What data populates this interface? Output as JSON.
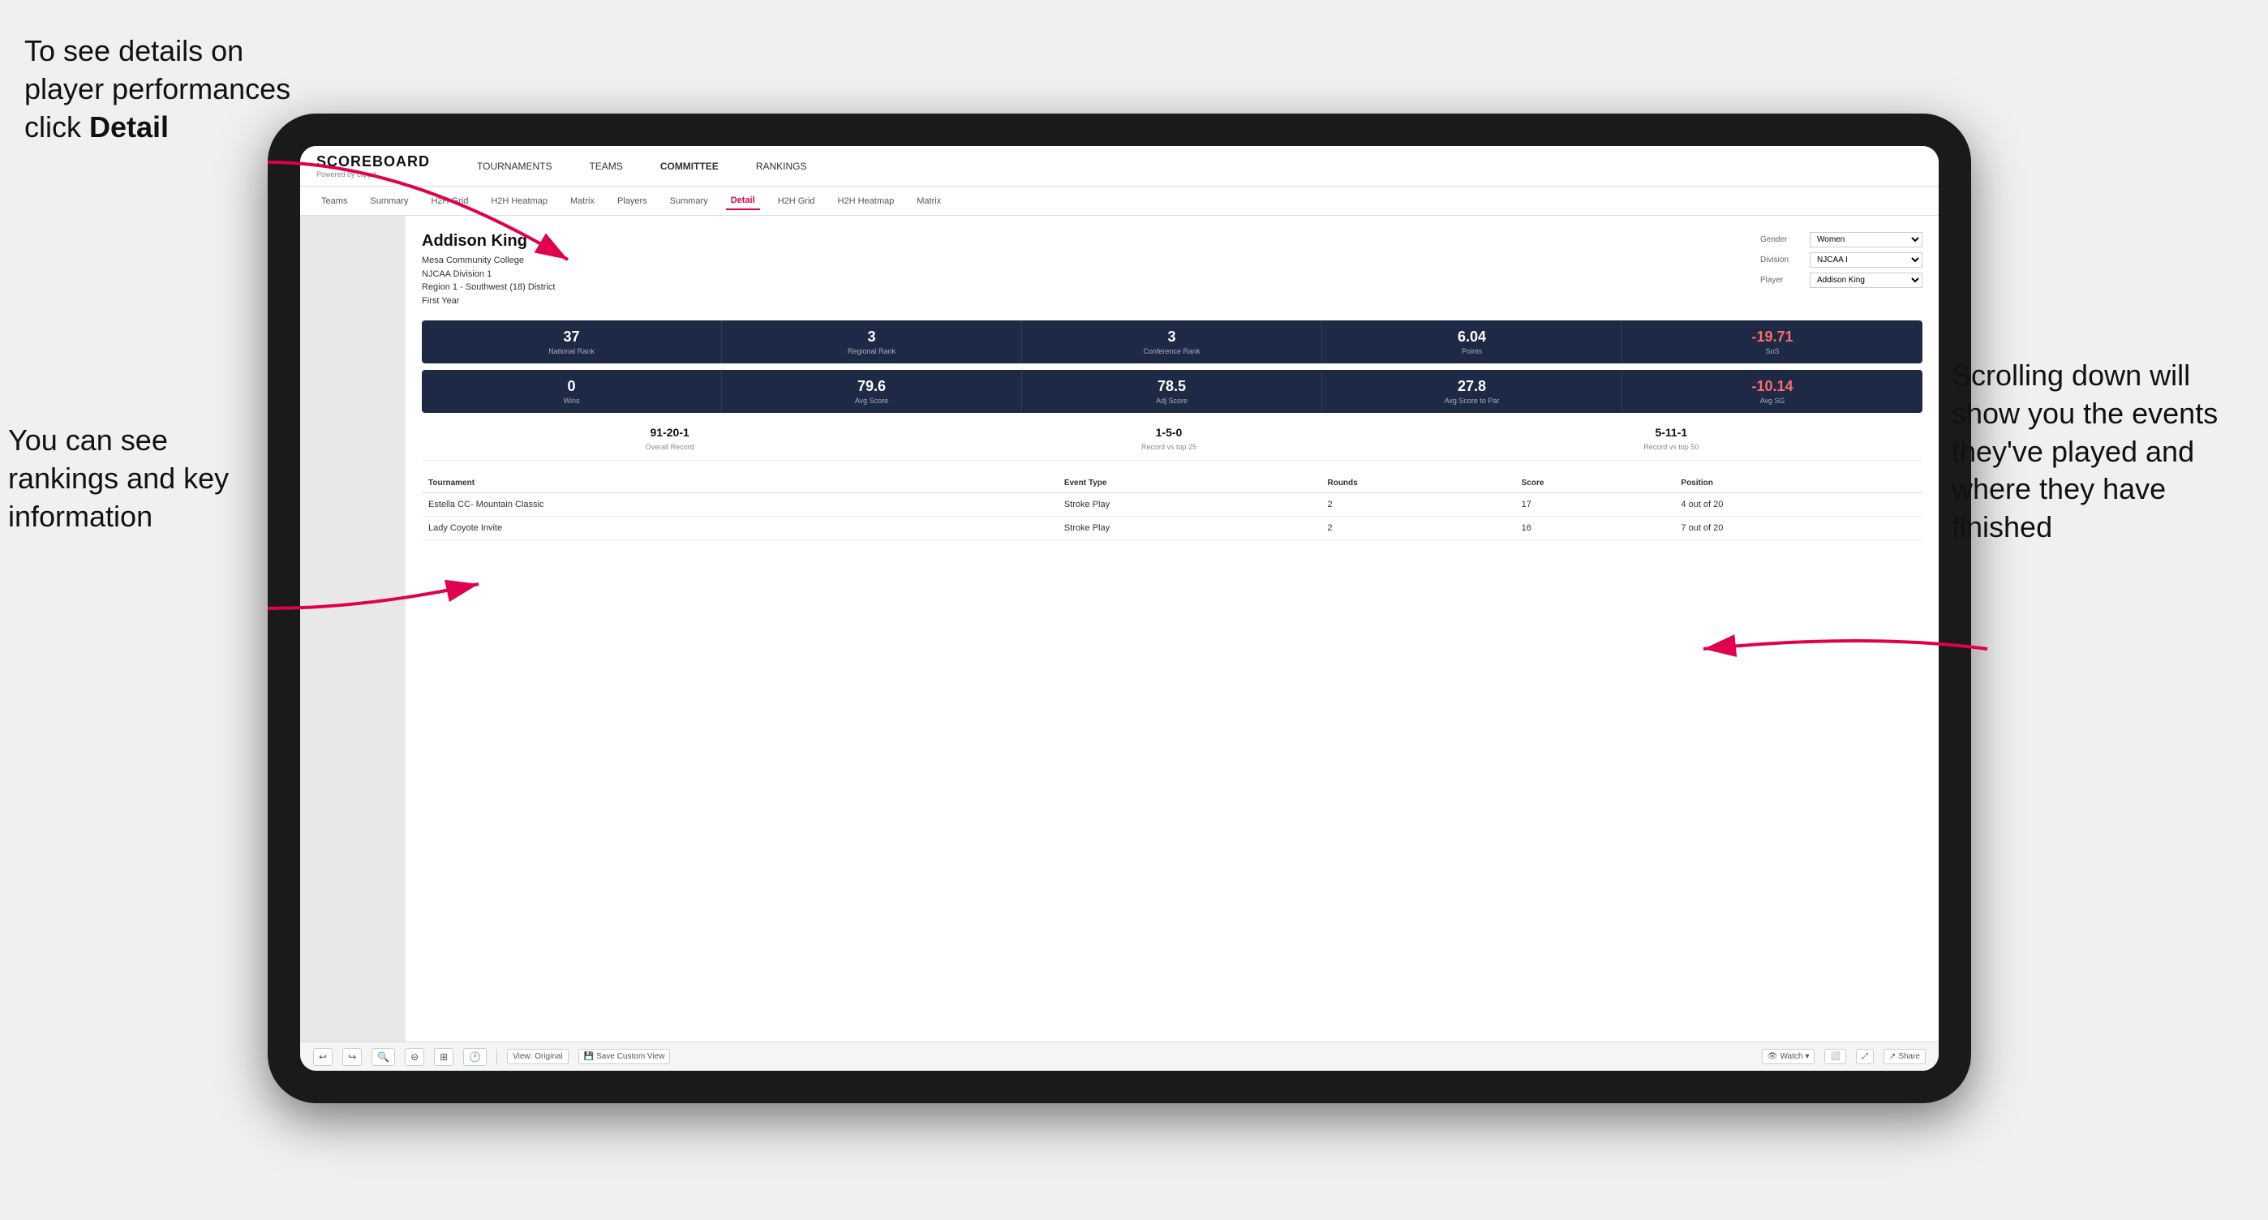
{
  "annotations": {
    "topleft": {
      "line1": "To see details on",
      "line2": "player performances",
      "line3": "click ",
      "bold": "Detail"
    },
    "bottomleft": {
      "line1": "You can see",
      "line2": "rankings and",
      "line3": "key information"
    },
    "right": {
      "line1": "Scrolling down",
      "line2": "will show you",
      "line3": "the events",
      "line4": "they've played",
      "line5": "and where they",
      "line6": "have finished"
    }
  },
  "nav": {
    "logo": "SCOREBOARD",
    "logo_sub": "Powered by clippd",
    "items": [
      "TOURNAMENTS",
      "TEAMS",
      "COMMITTEE",
      "RANKINGS"
    ]
  },
  "subnav": {
    "items": [
      "Teams",
      "Summary",
      "H2H Grid",
      "H2H Heatmap",
      "Matrix",
      "Players",
      "Summary",
      "Detail",
      "H2H Grid",
      "H2H Heatmap",
      "Matrix"
    ],
    "active": "Detail"
  },
  "player": {
    "name": "Addison King",
    "college": "Mesa Community College",
    "division": "NJCAA Division 1",
    "region": "Region 1 - Southwest (18) District",
    "year": "First Year"
  },
  "controls": {
    "gender_label": "Gender",
    "gender_value": "Women",
    "division_label": "Division",
    "division_value": "NJCAA I",
    "player_label": "Player",
    "player_value": "Addison King"
  },
  "stats_row1": [
    {
      "value": "37",
      "label": "National Rank"
    },
    {
      "value": "3",
      "label": "Regional Rank"
    },
    {
      "value": "3",
      "label": "Conference Rank"
    },
    {
      "value": "6.04",
      "label": "Points"
    },
    {
      "value": "-19.71",
      "label": "SoS",
      "negative": true
    }
  ],
  "stats_row2": [
    {
      "value": "0",
      "label": "Wins"
    },
    {
      "value": "79.6",
      "label": "Avg Score"
    },
    {
      "value": "78.5",
      "label": "Adj Score"
    },
    {
      "value": "27.8",
      "label": "Avg Score to Par"
    },
    {
      "value": "-10.14",
      "label": "Avg SG",
      "negative": true
    }
  ],
  "records": [
    {
      "value": "91-20-1",
      "label": "Overall Record"
    },
    {
      "value": "1-5-0",
      "label": "Record vs top 25"
    },
    {
      "value": "5-11-1",
      "label": "Record vs top 50"
    }
  ],
  "table": {
    "headers": [
      "Tournament",
      "",
      "Event Type",
      "Rounds",
      "Score",
      "Position"
    ],
    "rows": [
      {
        "tournament": "Estella CC- Mountain Classic",
        "event_type": "Stroke Play",
        "rounds": "2",
        "score": "17",
        "position": "4 out of 20"
      },
      {
        "tournament": "Lady Coyote Invite",
        "event_type": "Stroke Play",
        "rounds": "2",
        "score": "16",
        "position": "7 out of 20"
      }
    ]
  },
  "toolbar": {
    "undo": "↩",
    "redo": "↪",
    "view_original": "View: Original",
    "save_custom": "Save Custom View",
    "watch": "Watch",
    "share": "Share"
  }
}
